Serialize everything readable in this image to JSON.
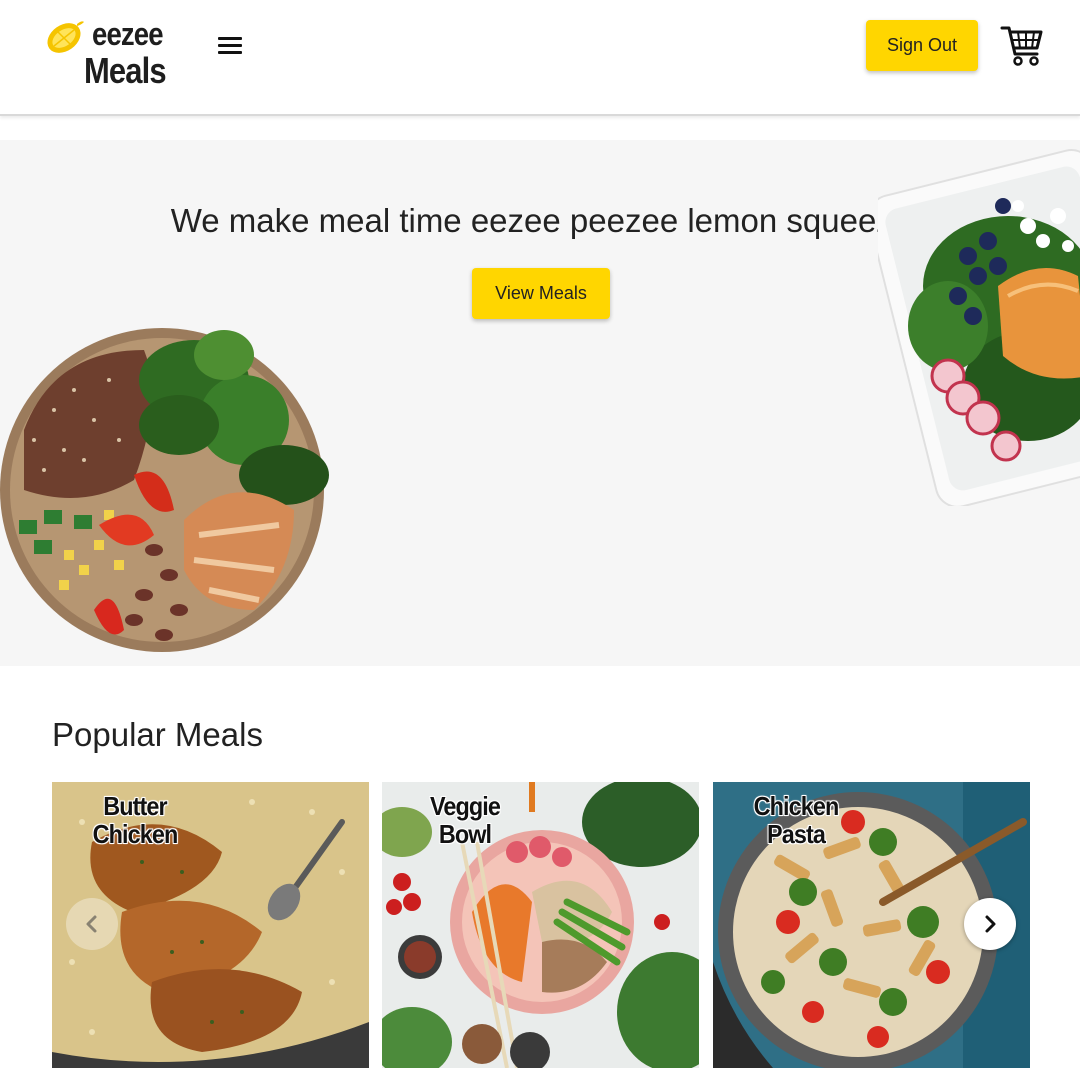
{
  "header": {
    "logo_line1": "eezee",
    "logo_line2": "Meals",
    "signout_label": "Sign Out"
  },
  "hero": {
    "tagline": "We make meal time eezee peezee lemon squeezy",
    "cta_label": "View Meals"
  },
  "popular": {
    "title": "Popular Meals",
    "meals": [
      {
        "name": "Butter Chicken"
      },
      {
        "name": "Veggie Bowl"
      },
      {
        "name": "Chicken Pasta"
      }
    ]
  },
  "theme": {
    "accent": "#ffd600",
    "hero_bg": "#f6f6f6"
  },
  "icons": {
    "logo": "lemon-icon",
    "menu": "hamburger-menu-icon",
    "cart": "shopping-cart-icon",
    "prev": "chevron-left-icon",
    "next": "chevron-right-icon"
  }
}
